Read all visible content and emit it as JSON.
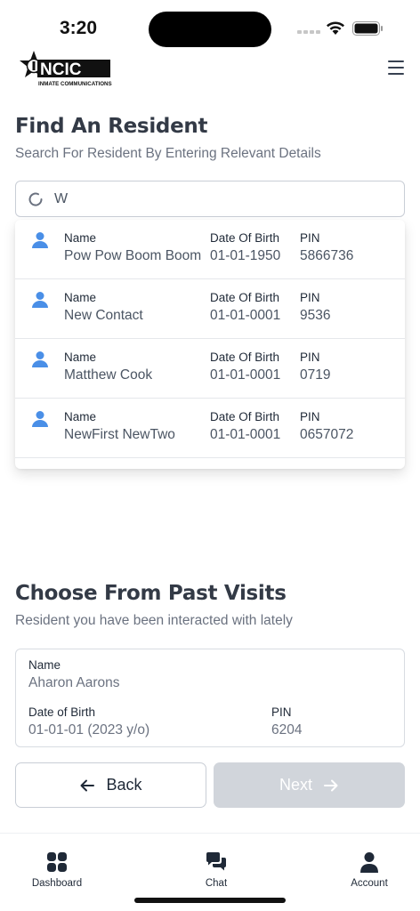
{
  "status_bar": {
    "time": "3:20"
  },
  "header": {
    "logo_text": "NCIC",
    "logo_subtext": "INMATE COMMUNICATIONS"
  },
  "find": {
    "title": "Find An Resident",
    "subtitle": "Search For Resident By Entering Relevant Details"
  },
  "search": {
    "value": "W"
  },
  "results": [
    {
      "name_label": "Name",
      "name": "Pow Pow Boom Boom",
      "dob_label": "Date Of Birth",
      "dob": "01-01-1950",
      "pin_label": "PIN",
      "pin": "5866736"
    },
    {
      "name_label": "Name",
      "name": "New Contact",
      "dob_label": "Date Of Birth",
      "dob": "01-01-0001",
      "pin_label": "PIN",
      "pin": "9536"
    },
    {
      "name_label": "Name",
      "name": "Matthew Cook",
      "dob_label": "Date Of Birth",
      "dob": "01-01-0001",
      "pin_label": "PIN",
      "pin": "0719"
    },
    {
      "name_label": "Name",
      "name": "NewFirst NewTwo",
      "dob_label": "Date Of Birth",
      "dob": "01-01-0001",
      "pin_label": "PIN",
      "pin": "0657072"
    }
  ],
  "past": {
    "title": "Choose From Past Visits",
    "subtitle": "Resident you have been interacted with lately",
    "card": {
      "name_label": "Name",
      "name": "Aharon Aarons",
      "dob_label": "Date of Birth",
      "dob": "01-01-01 (2023 y/o)",
      "pin_label": "PIN",
      "pin": "6204"
    }
  },
  "buttons": {
    "back": "Back",
    "next": "Next"
  },
  "nav": {
    "dashboard": "Dashboard",
    "chat": "Chat",
    "account": "Account"
  },
  "colors": {
    "accent_blue": "#4a8fe7",
    "heading": "#333a46",
    "disabled": "#d1d5db"
  }
}
